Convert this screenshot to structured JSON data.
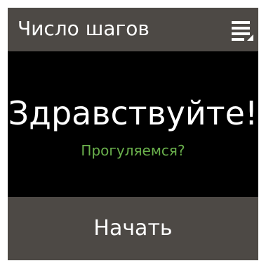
{
  "header": {
    "title": "Число шагов"
  },
  "main": {
    "greeting": "Здравствуйте!",
    "subtitle": "Прогуляемся?"
  },
  "footer": {
    "start_label": "Начать"
  },
  "colors": {
    "bar_background": "#4d4945",
    "screen_background": "#000000",
    "text_primary": "#ffffff",
    "accent_green": "#6ab04c"
  },
  "icons": {
    "menu": "menu-icon"
  }
}
